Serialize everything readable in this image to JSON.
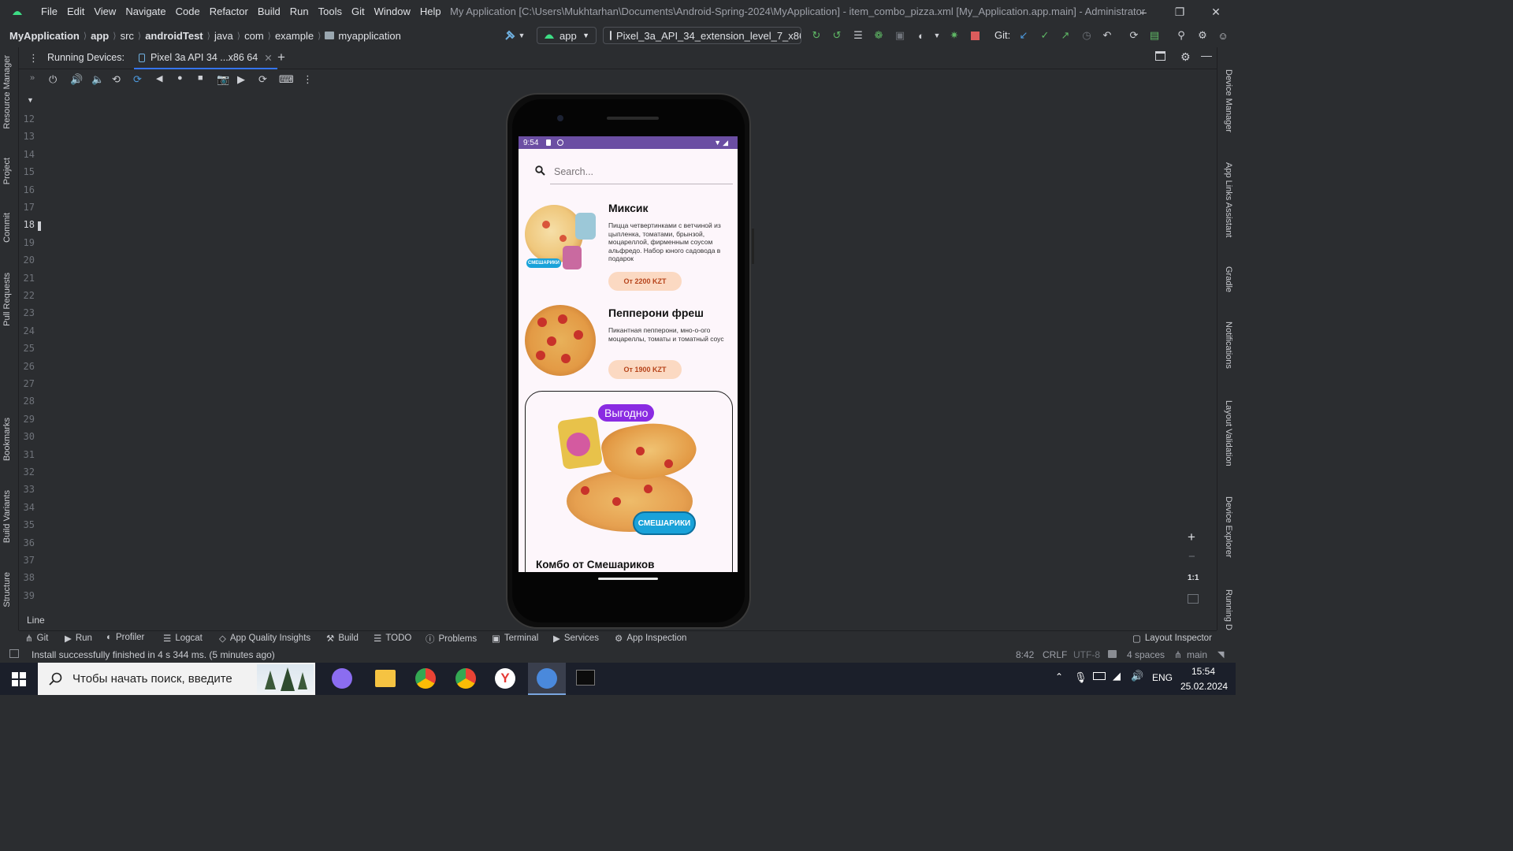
{
  "menu": [
    "File",
    "Edit",
    "View",
    "Navigate",
    "Code",
    "Refactor",
    "Build",
    "Run",
    "Tools",
    "Git",
    "Window",
    "Help"
  ],
  "window_title": "My Application [C:\\Users\\Mukhtarhan\\Documents\\Android-Spring-2024\\MyApplication] - item_combo_pizza.xml [My_Application.app.main] - Administrator",
  "breadcrumb": [
    {
      "label": "MyApplication",
      "bold": true
    },
    {
      "label": "app",
      "bold": true
    },
    {
      "label": "src",
      "bold": false
    },
    {
      "label": "androidTest",
      "bold": true
    },
    {
      "label": "java",
      "bold": false
    },
    {
      "label": "com",
      "bold": false
    },
    {
      "label": "example",
      "bold": false
    },
    {
      "label": "myapplication",
      "bold": false
    }
  ],
  "toolbar": {
    "run_config": "app",
    "device": "Pixel_3a_API_34_extension_level_7_x86...",
    "git_label": "Git:"
  },
  "running_devices": {
    "label": "Running Devices:",
    "tab": "Pixel 3a API 34 ...x86 64"
  },
  "left_stripe": [
    "Resource Manager",
    "Project",
    "Commit",
    "Pull Requests",
    "Bookmarks",
    "Build Variants",
    "Structure"
  ],
  "right_stripe": [
    "Device Manager",
    "App Links Assistant",
    "Gradle",
    "Notifications",
    "Layout Validation",
    "Device Explorer",
    "Running D"
  ],
  "gutter_lines": [
    "12",
    "13",
    "14",
    "15",
    "16",
    "17",
    "18",
    "19",
    "20",
    "21",
    "22",
    "23",
    "24",
    "25",
    "26",
    "27",
    "28",
    "29",
    "30",
    "31",
    "32",
    "33",
    "34",
    "35",
    "36",
    "37",
    "38",
    "39"
  ],
  "gutter_bottom": "Line",
  "phone": {
    "time": "9:54",
    "search_placeholder": "Search...",
    "items": [
      {
        "title": "Миксик",
        "desc": "Пицца четвертинками с ветчиной из цыпленка, томатами, брынзой, моцареллой, фирменным соусом альфредо. Набор юного садовода в подарок",
        "price": "От 2200 KZT"
      },
      {
        "title": "Пепперони фреш",
        "desc": "Пикантная пепперони, мно-о-ого моцареллы, томаты и томатный соус",
        "price": "От 1900 KZT"
      }
    ],
    "combo": {
      "badge": "Выгодно",
      "title": "Комбо от Смешариков",
      "brand": "СМЕШАРИКИ"
    }
  },
  "zoom_controls": {
    "plus": "+",
    "minus": "−",
    "one_to_one": "1:1"
  },
  "tool_windows": [
    "Git",
    "Run",
    "Profiler",
    "Logcat",
    "App Quality Insights",
    "Build",
    "TODO",
    "Problems",
    "Terminal",
    "Services",
    "App Inspection"
  ],
  "layout_inspector": "Layout Inspector",
  "status": {
    "message": "Install successfully finished in 4 s 344 ms. (5 minutes ago)",
    "position": "8:42",
    "line_sep": "CRLF",
    "encoding": "UTF-8",
    "indent": "4 spaces",
    "branch": "main"
  },
  "taskbar": {
    "search_text": "Чтобы начать поиск, введите",
    "lang": "ENG",
    "time": "15:54",
    "date": "25.02.2024"
  },
  "colors": {
    "accent": "#6b4ea3",
    "badge": "#8a2be2",
    "price_bg": "#fbd9c2",
    "price_text": "#b6441b"
  }
}
